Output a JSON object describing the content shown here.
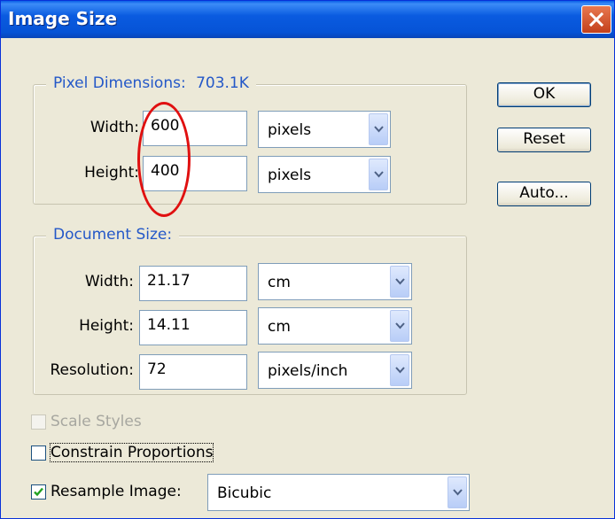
{
  "title": "Image Size",
  "pixel_dimensions": {
    "legend_label": "Pixel Dimensions:",
    "legend_size": "703.1K",
    "width_label": "Width:",
    "width_value": "600",
    "width_unit": "pixels",
    "height_label": "Height:",
    "height_value": "400",
    "height_unit": "pixels"
  },
  "document_size": {
    "legend": "Document Size:",
    "width_label": "Width:",
    "width_value": "21.17",
    "width_unit": "cm",
    "height_label": "Height:",
    "height_value": "14.11",
    "height_unit": "cm",
    "resolution_label": "Resolution:",
    "resolution_value": "72",
    "resolution_unit": "pixels/inch"
  },
  "buttons": {
    "ok": "OK",
    "reset": "Reset",
    "auto": "Auto..."
  },
  "options": {
    "scale_styles": {
      "label": "Scale Styles",
      "checked": false,
      "enabled": false
    },
    "constrain_proportions": {
      "label": "Constrain Proportions",
      "checked": false
    },
    "resample_image": {
      "label": "Resample Image:",
      "checked": true,
      "method": "Bicubic"
    }
  },
  "annotation": {
    "color": "#e01010"
  }
}
